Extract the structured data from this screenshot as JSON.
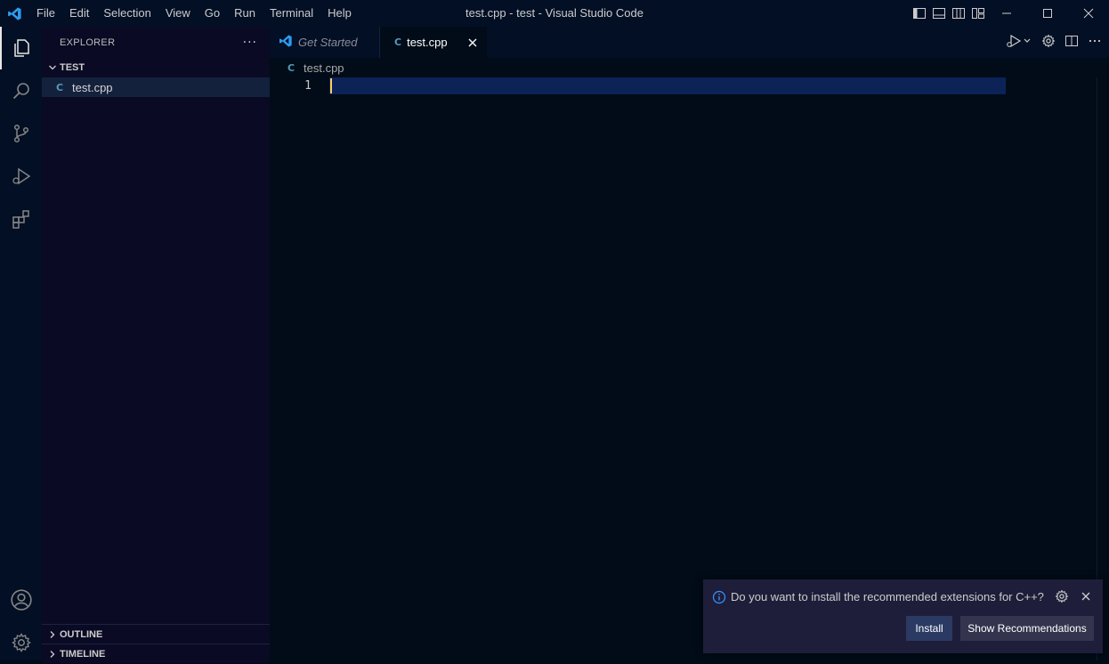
{
  "app": {
    "logo_icon": "vscode-logo-icon",
    "accent": "#0098ff"
  },
  "menu": [
    "File",
    "Edit",
    "Selection",
    "View",
    "Go",
    "Run",
    "Terminal",
    "Help"
  ],
  "window": {
    "title": "test.cpp - test - Visual Studio Code"
  },
  "activity_bar": {
    "items": [
      "explorer-icon",
      "search-icon",
      "source-control-icon",
      "run-debug-icon",
      "extensions-icon"
    ],
    "bottom": [
      "account-icon",
      "manage-gear-icon"
    ]
  },
  "sidebar": {
    "title": "EXPLORER",
    "more": "···",
    "folder": "TEST",
    "files": [
      {
        "name": "test.cpp",
        "icon": "C"
      }
    ],
    "outline": "OUTLINE",
    "timeline": "TIMELINE"
  },
  "tabs": [
    {
      "label": "Get Started",
      "active": false
    },
    {
      "label": "test.cpp",
      "active": true,
      "icon": "C"
    }
  ],
  "breadcrumb": {
    "file": "test.cpp",
    "icon": "C"
  },
  "editor": {
    "line_numbers": [
      "1"
    ],
    "cursor_color": "#ffcc66"
  },
  "notification": {
    "message": "Do you want to install the recommended extensions for C++?",
    "install_label": "Install",
    "show_recommendations_label": "Show Recommendations"
  }
}
